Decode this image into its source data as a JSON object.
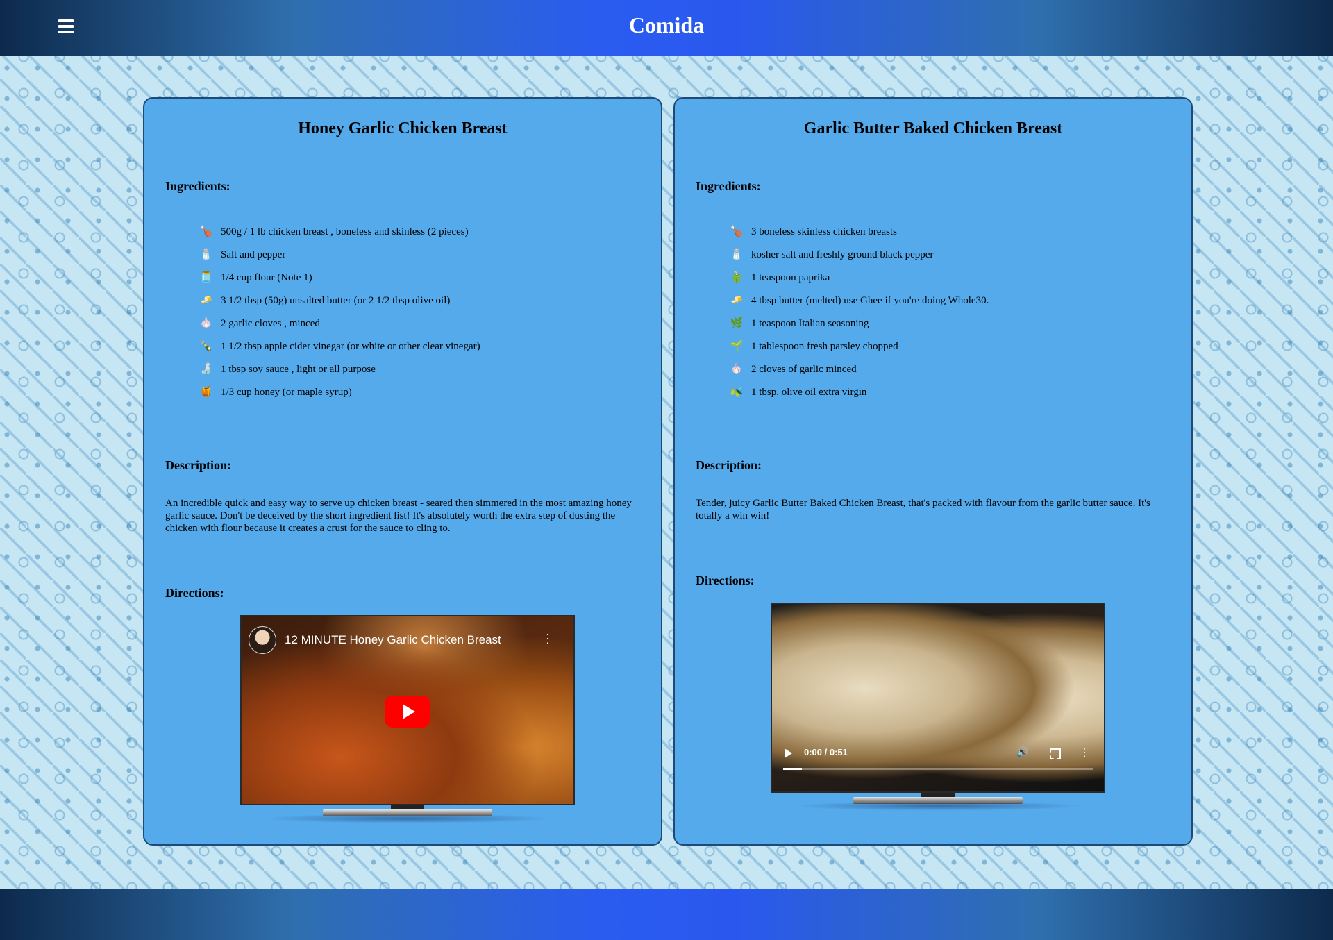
{
  "header": {
    "title": "Comida",
    "menu_icon": "hamburger-menu-icon"
  },
  "labels": {
    "ingredients": "Ingredients:",
    "description": "Description:",
    "directions": "Directions:"
  },
  "recipes": [
    {
      "title": "Honey Garlic Chicken Breast",
      "ingredients": [
        {
          "icon": "chicken-breast-icon",
          "text": "500g / 1 lb chicken breast , boneless and skinless (2 pieces)"
        },
        {
          "icon": "salt-pepper-shakers-icon",
          "text": "Salt and pepper"
        },
        {
          "icon": "flour-jar-icon",
          "text": "1/4 cup flour (Note 1)"
        },
        {
          "icon": "butter-icon",
          "text": "3 1/2 tbsp (50g) unsalted butter (or 2 1/2 tbsp olive oil)"
        },
        {
          "icon": "garlic-icon",
          "text": "2 garlic cloves , minced"
        },
        {
          "icon": "vinegar-bottle-icon",
          "text": "1 1/2 tbsp apple cider vinegar (or white or other clear vinegar)"
        },
        {
          "icon": "soy-sauce-icon",
          "text": "1 tbsp soy sauce , light or all purpose"
        },
        {
          "icon": "honey-jar-icon",
          "text": "1/3 cup honey (or maple syrup)"
        }
      ],
      "description": "An incredible quick and easy way to serve up chicken breast - seared then simmered in the most amazing honey garlic sauce. Don't be deceived by the short ingredient list! It's absolutely worth the extra step of dusting the chicken with flour because it creates a crust for the sauce to cling to.",
      "video": {
        "kind": "youtube",
        "title": "12 MINUTE Honey Garlic Chicken Breast",
        "more_icon": "kebab-menu-icon",
        "play_icon": "youtube-play-icon"
      }
    },
    {
      "title": "Garlic Butter Baked Chicken Breast",
      "ingredients": [
        {
          "icon": "chicken-breast-icon",
          "text": "3 boneless skinless chicken breasts"
        },
        {
          "icon": "salt-pepper-shakers-icon",
          "text": "kosher salt and freshly ground black pepper"
        },
        {
          "icon": "paprika-pepper-icon",
          "text": "1 teaspoon paprika"
        },
        {
          "icon": "butter-icon",
          "text": "4 tbsp butter (melted) use Ghee if you're doing Whole30."
        },
        {
          "icon": "seasoning-icon",
          "text": "1 teaspoon Italian seasoning"
        },
        {
          "icon": "parsley-icon",
          "text": "1 tablespoon fresh parsley chopped"
        },
        {
          "icon": "garlic-icon",
          "text": "2 cloves of garlic minced"
        },
        {
          "icon": "olive-oil-icon",
          "text": "1 tbsp. olive oil extra virgin"
        }
      ],
      "description": "Tender, juicy Garlic Butter Baked Chicken Breast, that's packed with flavour from the garlic butter sauce. It's totally a win win!",
      "video": {
        "kind": "html5",
        "time": "0:00 / 0:51",
        "progress": 0.06
      }
    }
  ],
  "colors": {
    "card_bg": "#55aaec",
    "card_border": "#1f4a78",
    "header_accent": "#2a58ee",
    "youtube_red": "#ff0000"
  }
}
